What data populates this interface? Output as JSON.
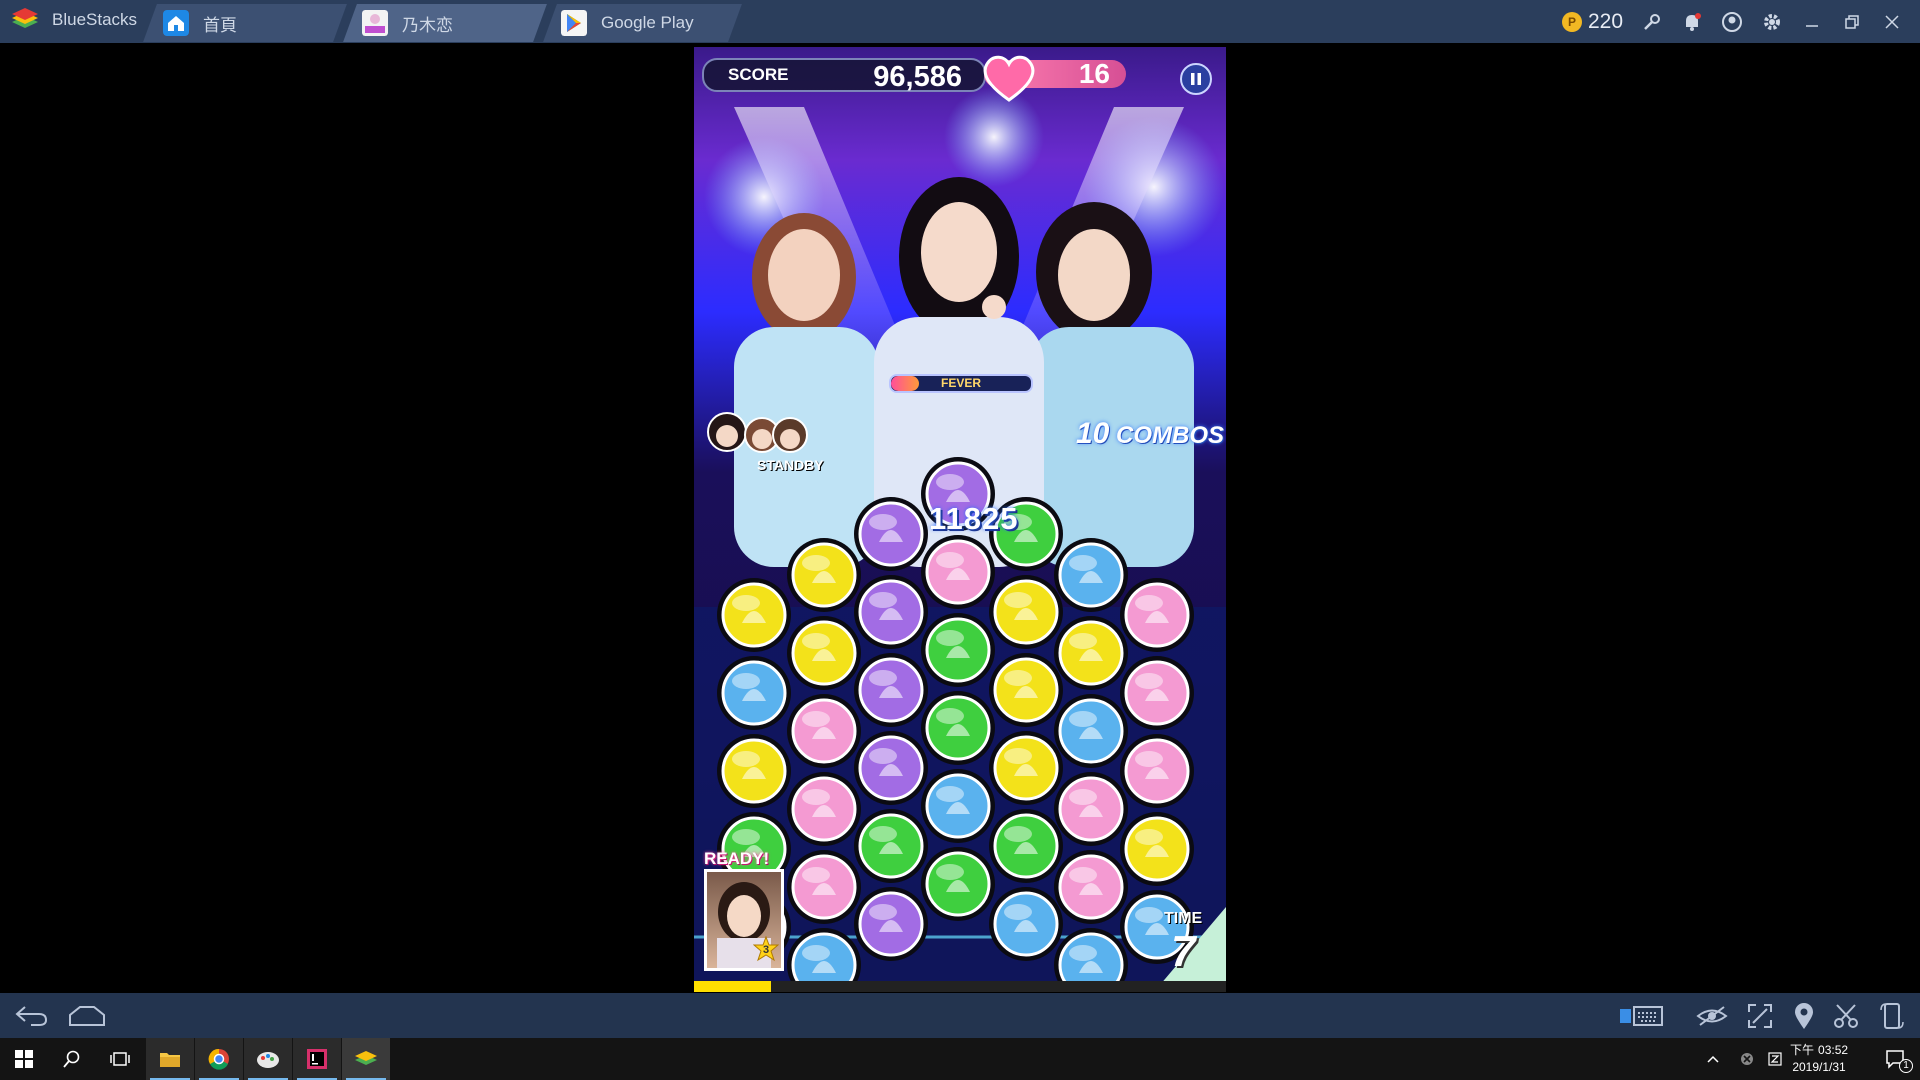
{
  "app": {
    "name": "BlueStacks",
    "coins": "220"
  },
  "tabs": [
    {
      "label": "首頁",
      "icon": "home-icon"
    },
    {
      "label": "乃木恋",
      "icon": "nogikoi-app-icon"
    },
    {
      "label": "Google Play",
      "icon": "google-play-icon"
    }
  ],
  "title_icons": [
    "key-icon",
    "bell-icon",
    "account-icon",
    "gear-icon",
    "minimize-icon",
    "restore-icon",
    "close-icon"
  ],
  "game": {
    "score_label": "SCORE",
    "score": "96,586",
    "hearts": "16",
    "fever_label": "FEVER",
    "fever_level": 0.2,
    "combo_count": "10",
    "combo_label": "COMBOS",
    "standby_label": "STANDBY",
    "chain_score": "11825",
    "ready_label": "READY!",
    "ready_stars": "3",
    "time_label": "TIME",
    "time_value": "7",
    "time_progress": 0.145,
    "board_colors": {
      "yellow": "#f3e21a",
      "blue": "#5ab2ee",
      "green": "#3fcf3f",
      "pink": "#f49ad2",
      "purple": "#a26ce4"
    },
    "pieces": [
      [
        "yellow",
        0
      ],
      [
        "blue",
        1
      ],
      [
        "yellow",
        2
      ],
      [
        "green",
        3
      ],
      [
        "green",
        4
      ],
      [
        "yellow",
        5
      ],
      [
        "yellow",
        6
      ],
      [
        "pink",
        7
      ],
      [
        "pink",
        8
      ],
      [
        "pink",
        9
      ],
      [
        "blue",
        10
      ],
      [
        "purple",
        11
      ],
      [
        "purple",
        12
      ],
      [
        "purple",
        13
      ],
      [
        "purple",
        14
      ],
      [
        "green",
        15
      ],
      [
        "purple",
        16
      ],
      [
        "purple",
        17
      ],
      [
        "pink",
        18
      ],
      [
        "green",
        19
      ],
      [
        "green",
        20
      ],
      [
        "blue",
        21
      ],
      [
        "green",
        22
      ],
      [
        "green",
        23
      ],
      [
        "yellow",
        24
      ],
      [
        "yellow",
        25
      ],
      [
        "yellow",
        26
      ],
      [
        "green",
        27
      ],
      [
        "blue",
        28
      ],
      [
        "blue",
        29
      ],
      [
        "yellow",
        30
      ],
      [
        "blue",
        31
      ],
      [
        "pink",
        32
      ],
      [
        "pink",
        33
      ],
      [
        "blue",
        34
      ],
      [
        "pink",
        35
      ],
      [
        "pink",
        36
      ],
      [
        "pink",
        37
      ],
      [
        "yellow",
        38
      ],
      [
        "blue",
        39
      ]
    ]
  },
  "nav": {
    "left": [
      "back-icon",
      "home-icon"
    ],
    "right": [
      "keyboard-mapping-icon",
      "visibility-icon",
      "fullscreen-icon",
      "location-icon",
      "screenshot-icon",
      "rotate-icon"
    ]
  },
  "taskbar": {
    "apps": [
      "windows-start-icon",
      "search-icon",
      "task-view-icon",
      "file-explorer-icon",
      "chrome-icon",
      "paint-icon",
      "intellij-icon",
      "bluestacks-icon"
    ],
    "clock_period": "下午",
    "time": "03:52",
    "date": "2019/1/31",
    "notifications": "1"
  }
}
